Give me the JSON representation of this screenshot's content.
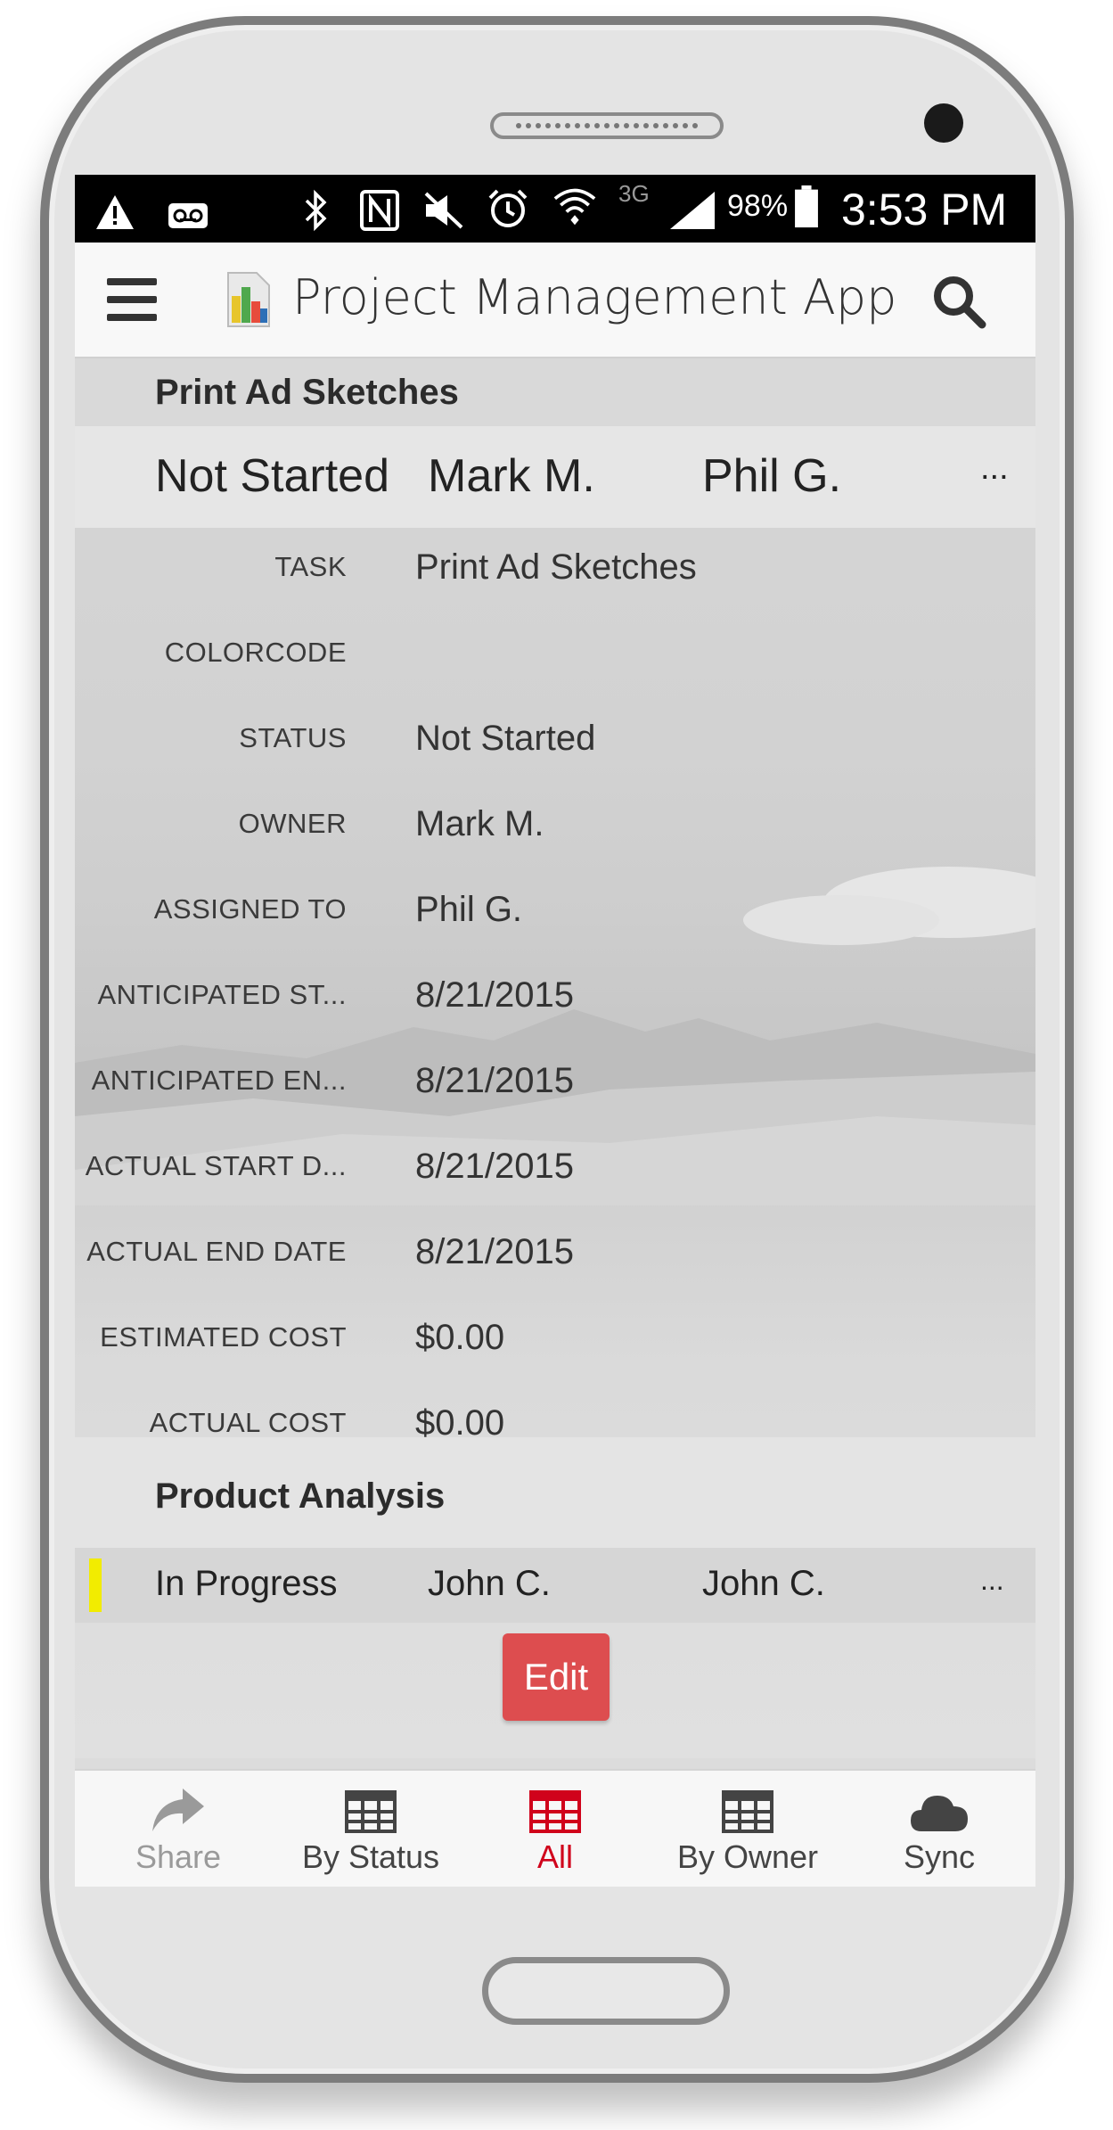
{
  "status_bar": {
    "battery_percent": "98%",
    "network": "3G",
    "time": "3:53 PM",
    "icons": [
      "warning-icon",
      "voicemail-icon",
      "bluetooth-icon",
      "nfc-icon",
      "mute-icon",
      "alarm-icon",
      "wifi-icon",
      "signal-icon",
      "battery-icon"
    ]
  },
  "app_bar": {
    "title": "Project Management App"
  },
  "current_record": {
    "header": "Print Ad Sketches",
    "summary": {
      "status": "Not Started",
      "owner": "Mark M.",
      "assigned_to": "Phil G.",
      "more": "..."
    },
    "fields": [
      {
        "label": "TASK",
        "value": "Print Ad Sketches"
      },
      {
        "label": "COLORCODE",
        "value": ""
      },
      {
        "label": "STATUS",
        "value": "Not Started"
      },
      {
        "label": "OWNER",
        "value": "Mark M."
      },
      {
        "label": "ASSIGNED TO",
        "value": "Phil G."
      },
      {
        "label": "ANTICIPATED ST...",
        "value": "8/21/2015"
      },
      {
        "label": "ANTICIPATED EN...",
        "value": "8/21/2015"
      },
      {
        "label": "ACTUAL START D...",
        "value": "8/21/2015"
      },
      {
        "label": "ACTUAL END DATE",
        "value": "8/21/2015"
      },
      {
        "label": "ESTIMATED COST",
        "value": "$0.00"
      },
      {
        "label": "ACTUAL COST",
        "value": "$0.00"
      }
    ]
  },
  "next_record": {
    "header": "Product Analysis",
    "color_code": "#f2ec00",
    "summary": {
      "status": "In Progress",
      "owner": "John C.",
      "assigned_to": "John C.",
      "more": "..."
    }
  },
  "edit_button": {
    "label": "Edit",
    "color": "#dd4d4f"
  },
  "bottom_nav": {
    "items": [
      {
        "label": "Share",
        "icon": "share-icon",
        "state": "disabled"
      },
      {
        "label": "By Status",
        "icon": "grid-icon",
        "state": "normal"
      },
      {
        "label": "All",
        "icon": "grid-icon",
        "state": "active"
      },
      {
        "label": "By Owner",
        "icon": "grid-icon",
        "state": "normal"
      },
      {
        "label": "Sync",
        "icon": "cloud-icon",
        "state": "normal"
      }
    ],
    "active_color": "#d0021b"
  }
}
